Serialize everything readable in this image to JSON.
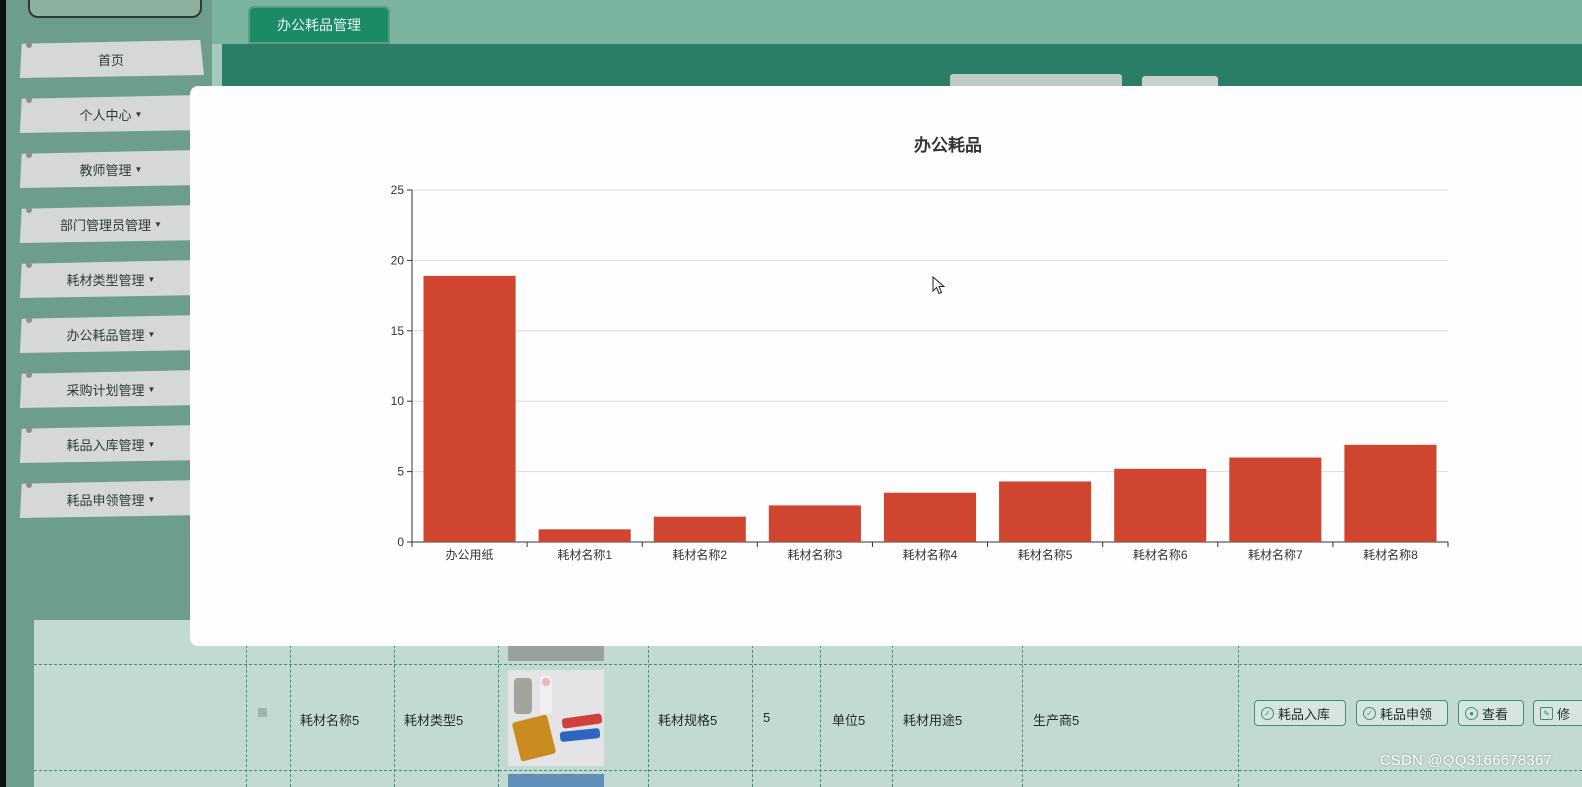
{
  "sidebar": {
    "items": [
      {
        "label": "首页",
        "has_dropdown": false
      },
      {
        "label": "个人中心",
        "has_dropdown": true
      },
      {
        "label": "教师管理",
        "has_dropdown": true
      },
      {
        "label": "部门管理员管理",
        "has_dropdown": true
      },
      {
        "label": "耗材类型管理",
        "has_dropdown": true
      },
      {
        "label": "办公耗品管理",
        "has_dropdown": true
      },
      {
        "label": "采购计划管理",
        "has_dropdown": true
      },
      {
        "label": "耗品入库管理",
        "has_dropdown": true
      },
      {
        "label": "耗品申领管理",
        "has_dropdown": true
      }
    ]
  },
  "tabs": {
    "active": "办公耗品管理"
  },
  "table": {
    "row": {
      "name": "耗材名称5",
      "type": "耗材类型5",
      "spec": "耗材规格5",
      "quantity": "5",
      "unit": "单位5",
      "usage": "耗材用途5",
      "manufacturer": "生产商5"
    },
    "actions": [
      {
        "label": "耗品入库",
        "icon": "check-circle-icon"
      },
      {
        "label": "耗品申领",
        "icon": "check-circle-icon"
      },
      {
        "label": "查看",
        "icon": "eye-icon"
      },
      {
        "label": "修",
        "icon": "edit-icon"
      }
    ]
  },
  "chart_data": {
    "type": "bar",
    "title": "办公耗品",
    "categories": [
      "办公用纸",
      "耗材名称1",
      "耗材名称2",
      "耗材名称3",
      "耗材名称4",
      "耗材名称5",
      "耗材名称6",
      "耗材名称7",
      "耗材名称8"
    ],
    "values": [
      18.9,
      0.9,
      1.8,
      2.6,
      3.5,
      4.3,
      5.2,
      6.0,
      6.9
    ],
    "ylim": [
      0,
      25
    ],
    "yticks": [
      0,
      5,
      10,
      15,
      20,
      25
    ],
    "bar_color": "#d04530",
    "grid": true
  },
  "watermark": "CSDN @QQ3166678367",
  "colors": {
    "sidebar_bg": "#6d9e8c",
    "menu_bg": "#d5d8d7",
    "accent": "#1b8a67",
    "band": "#2a7d66"
  }
}
